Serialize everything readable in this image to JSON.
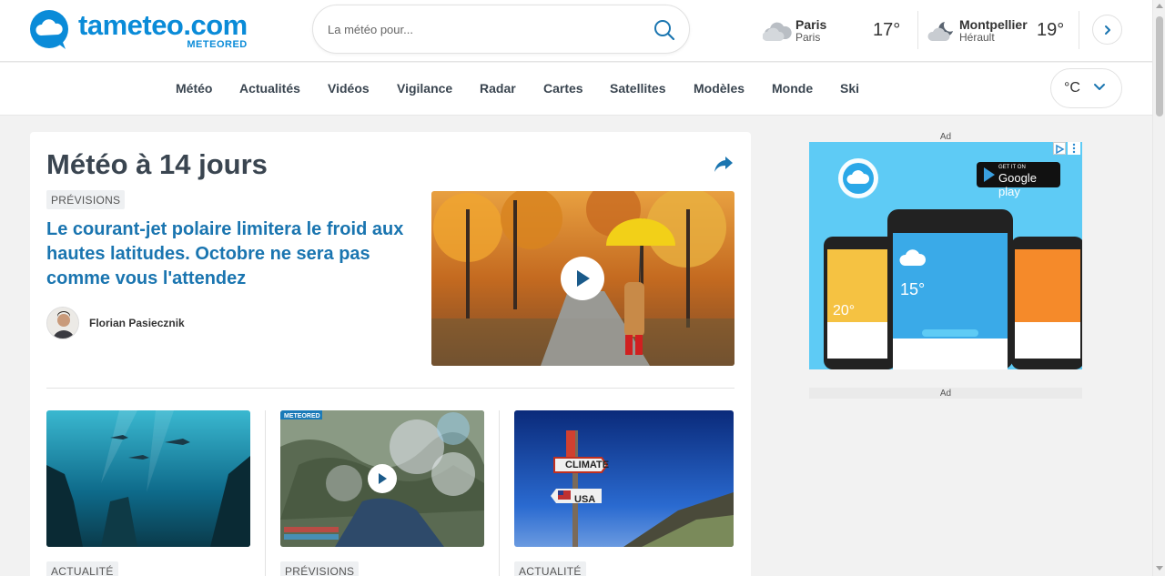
{
  "brand": {
    "name": "tameteo.com",
    "sub": "METEORED",
    "color": "#0a8bd8"
  },
  "search": {
    "placeholder": "La météo pour..."
  },
  "cities": [
    {
      "name": "Paris",
      "region": "Paris",
      "temp": "17°",
      "icon": "cloudy-icon"
    },
    {
      "name": "Montpellier",
      "region": "Hérault",
      "temp": "19°",
      "icon": "moon-cloud-icon"
    }
  ],
  "nav": {
    "items": [
      "Météo",
      "Actualités",
      "Vidéos",
      "Vigilance",
      "Radar",
      "Cartes",
      "Satellites",
      "Modèles",
      "Monde",
      "Ski"
    ],
    "unit": "°C"
  },
  "main": {
    "title": "Météo à 14 jours",
    "featured": {
      "tag": "PRÉVISIONS",
      "headline": "Le courant-jet polaire limitera le froid aux hautes latitudes. Octobre ne sera pas comme vous l'attendez",
      "author": "Florian Pasiecznik"
    },
    "articles": [
      {
        "tag": "ACTUALITÉ",
        "image": "underwater-sharks"
      },
      {
        "tag": "PRÉVISIONS",
        "image": "satellite-map",
        "video": true,
        "badge": "METEORED"
      },
      {
        "tag": "ACTUALITÉ",
        "image": "climate-usa-signpost"
      }
    ]
  },
  "ads": {
    "label": "Ad",
    "store_small": "GET IT ON",
    "store_big": "Google play"
  },
  "colors": {
    "link": "#1a75b0",
    "heading": "#3a4550",
    "ad_bg": "#5ecbf5"
  }
}
